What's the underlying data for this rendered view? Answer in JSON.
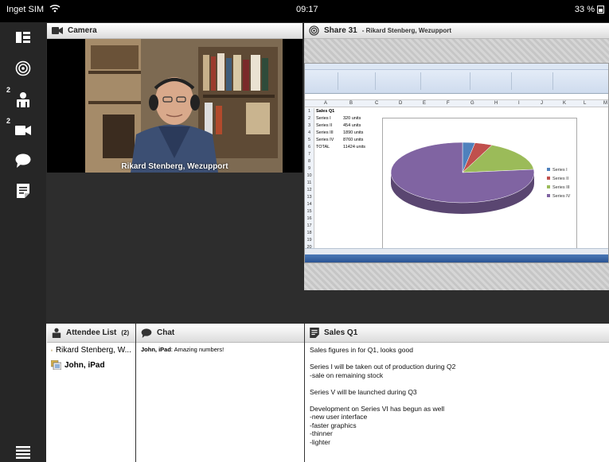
{
  "status_bar": {
    "carrier": "Inget SIM",
    "time": "09:17",
    "battery": "33 %"
  },
  "sidebar": {
    "attendee_badge": "2",
    "camera_badge": "2"
  },
  "camera_panel": {
    "title": "Camera",
    "caption": "Rikard Stenberg, Wezupport"
  },
  "share_panel": {
    "title": "Share 31",
    "subtitle": "- Rikard Stenberg, Wezupport",
    "spreadsheet": {
      "columns": [
        "A",
        "B",
        "C",
        "D",
        "E",
        "F",
        "G",
        "H",
        "I",
        "J",
        "K",
        "L",
        "M"
      ],
      "row_numbers": [
        "1",
        "2",
        "3",
        "4",
        "5",
        "6",
        "7",
        "8",
        "9",
        "10",
        "11",
        "12",
        "13",
        "14",
        "15",
        "16",
        "17",
        "18",
        "19",
        "20"
      ],
      "rows": [
        {
          "a": "Sales Q1",
          "b": ""
        },
        {
          "a": "Series I",
          "b": "320 units"
        },
        {
          "a": "Series II",
          "b": "454 units"
        },
        {
          "a": "Series III",
          "b": "1890 units"
        },
        {
          "a": "Series IV",
          "b": "8760 units"
        },
        {
          "a": "TOTAL",
          "b": "11424 units"
        }
      ],
      "pie_legend": [
        "Series I",
        "Series II",
        "Series III",
        "Series IV"
      ]
    }
  },
  "chart_data": {
    "type": "pie",
    "categories": [
      "Series I",
      "Series II",
      "Series III",
      "Series IV"
    ],
    "values": [
      320,
      454,
      1890,
      8760
    ],
    "colors": [
      "#4f81bd",
      "#c0504d",
      "#9bbb59",
      "#8064a2"
    ],
    "legend": "right"
  },
  "attendee_panel": {
    "title": "Attendee List",
    "count": "(2)",
    "attendees": [
      {
        "name": "Rikard Stenberg, W..."
      },
      {
        "name": "John, iPad"
      }
    ]
  },
  "chat_panel": {
    "title": "Chat",
    "messages": [
      {
        "sender": "John, iPad",
        "text": ": Amazing numbers!"
      }
    ]
  },
  "notes_panel": {
    "title": "Sales Q1",
    "lines": [
      "Sales figures in for Q1, looks good",
      "",
      "Series I will be taken out of production during Q2",
      "-sale on remaining stock",
      "",
      "Series V will be launched during Q3",
      "",
      "Development on Series VI has begun as well",
      "-new user interface",
      "-faster graphics",
      "-thinner",
      "-lighter"
    ]
  }
}
